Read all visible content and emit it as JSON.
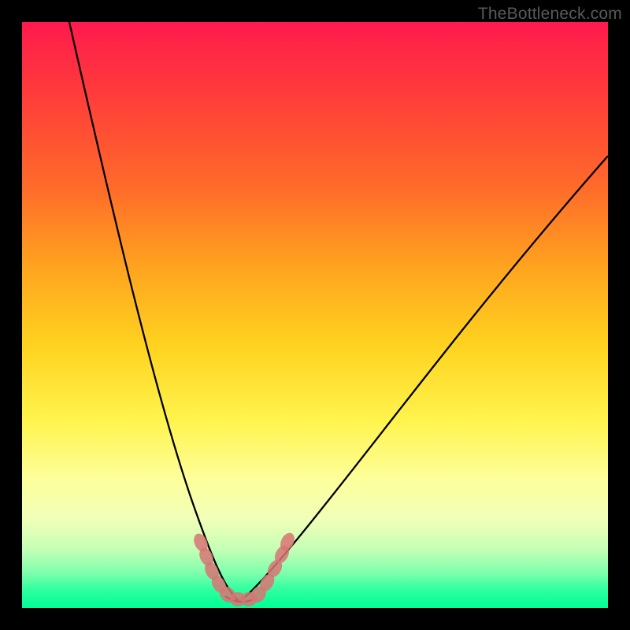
{
  "watermark": {
    "text": "TheBottleneck.com"
  },
  "chart_data": {
    "type": "line",
    "title": "",
    "xlabel": "",
    "ylabel": "",
    "xlim": [
      0,
      100
    ],
    "ylim": [
      0,
      100
    ],
    "series": [
      {
        "name": "bottleneck-curve",
        "x": [
          0,
          5,
          10,
          15,
          20,
          25,
          28,
          30,
          32,
          34,
          36,
          38,
          40,
          45,
          50,
          55,
          60,
          65,
          70,
          75,
          80,
          85,
          90,
          95,
          100
        ],
        "y": [
          100,
          85,
          70,
          56,
          42,
          28,
          18,
          12,
          6,
          2,
          0,
          0,
          2,
          6,
          12,
          19,
          26,
          33,
          40,
          47,
          53,
          60,
          66,
          72,
          78
        ]
      }
    ],
    "annotations": [
      {
        "name": "bottom-band-markers",
        "color": "#d87474",
        "points": [
          {
            "x": 30.5,
            "y": 11
          },
          {
            "x": 31.5,
            "y": 9
          },
          {
            "x": 32.5,
            "y": 5.5
          },
          {
            "x": 33.7,
            "y": 3.5
          },
          {
            "x": 35.0,
            "y": 2
          },
          {
            "x": 36.5,
            "y": 1.5
          },
          {
            "x": 38.0,
            "y": 1.3
          },
          {
            "x": 39.5,
            "y": 2
          },
          {
            "x": 41.0,
            "y": 4
          },
          {
            "x": 42.5,
            "y": 6.5
          },
          {
            "x": 44.0,
            "y": 9
          },
          {
            "x": 45.0,
            "y": 11
          }
        ]
      }
    ],
    "background_gradient": {
      "stops": [
        {
          "pos": 0.0,
          "color": "#ff1a4d"
        },
        {
          "pos": 0.85,
          "color": "#fdff9b"
        },
        {
          "pos": 1.0,
          "color": "#00ff95"
        }
      ]
    }
  }
}
